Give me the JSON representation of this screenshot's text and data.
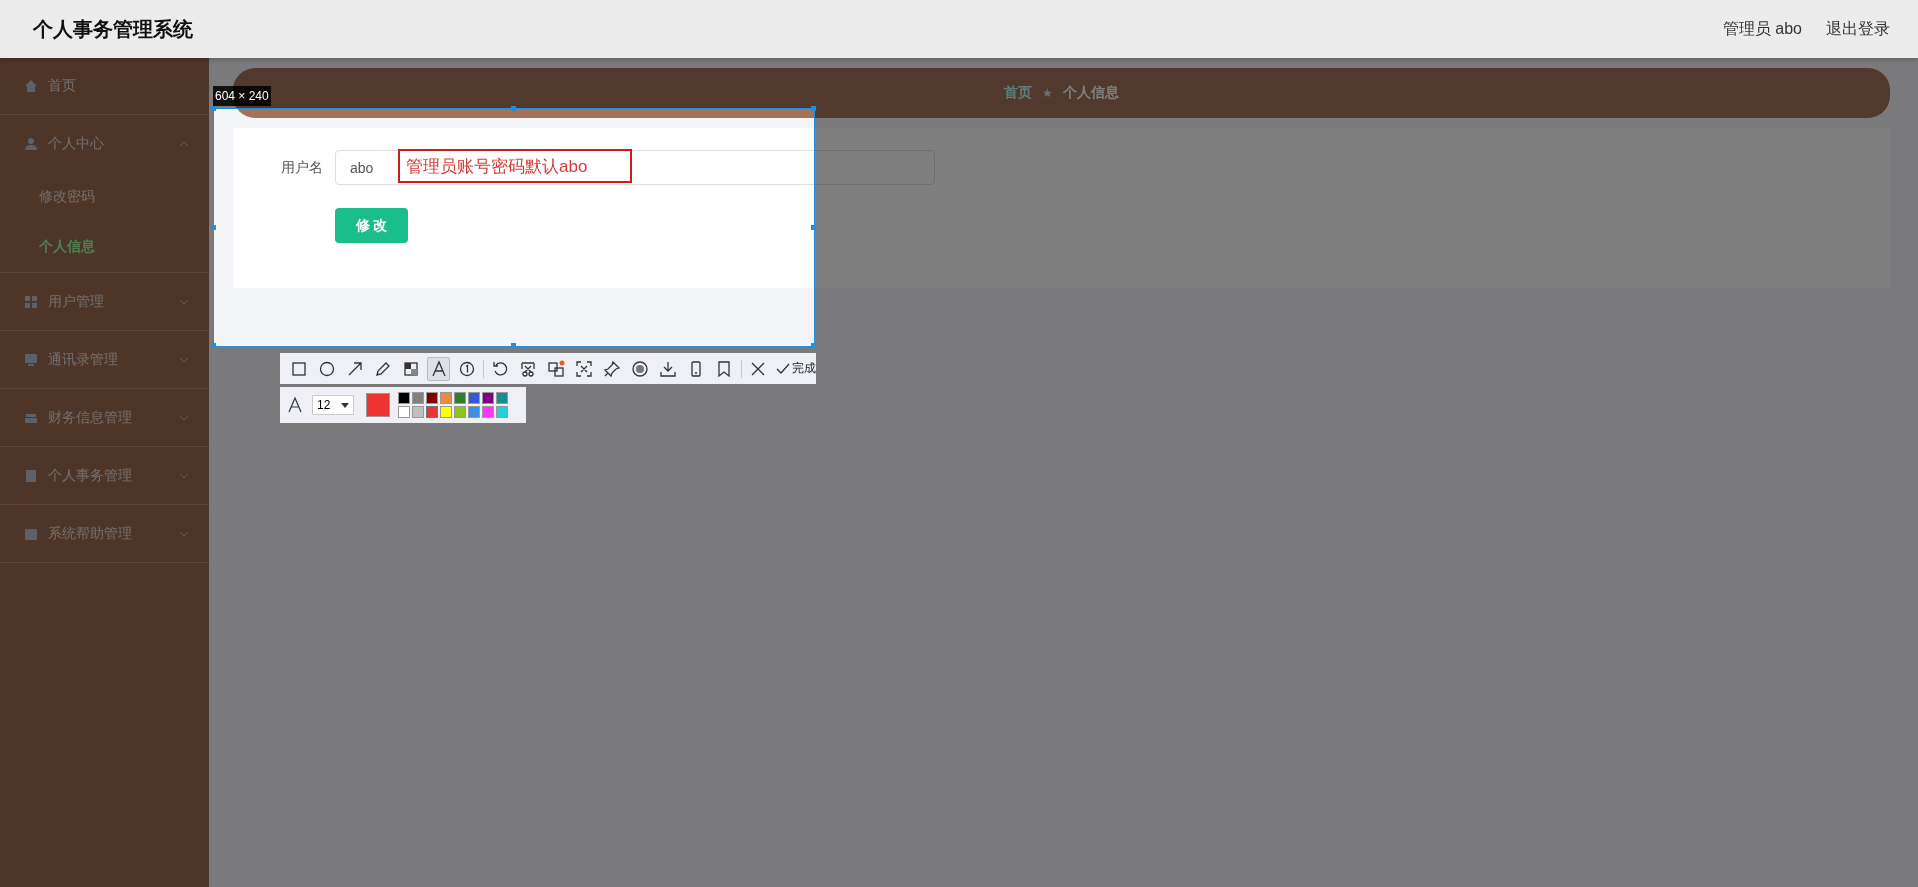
{
  "header": {
    "title": "个人事务管理系统",
    "user": "管理员 abo",
    "logout": "退出登录"
  },
  "sidebar": {
    "items": [
      {
        "kind": "link",
        "label": "首页"
      },
      {
        "kind": "group",
        "label": "个人中心",
        "expanded": true,
        "children": [
          {
            "label": "修改密码",
            "selected": false
          },
          {
            "label": "个人信息",
            "selected": true
          }
        ]
      },
      {
        "kind": "group",
        "label": "用户管理",
        "expanded": false
      },
      {
        "kind": "group",
        "label": "通讯录管理",
        "expanded": false
      },
      {
        "kind": "group",
        "label": "财务信息管理",
        "expanded": false
      },
      {
        "kind": "group",
        "label": "个人事务管理",
        "expanded": false
      },
      {
        "kind": "group",
        "label": "系统帮助管理",
        "expanded": false
      }
    ]
  },
  "breadcrumb": {
    "home": "首页",
    "separator": "★",
    "current": "个人信息"
  },
  "form": {
    "fields": [
      {
        "label": "用户名",
        "value": "abo"
      }
    ],
    "submit": "修 改"
  },
  "capture_tool": {
    "size_label": "604 × 240",
    "annotation": "管理员账号密码默认abo",
    "tools": [
      {
        "kind": "rectangle",
        "selected": false
      },
      {
        "kind": "ellipse",
        "selected": false
      },
      {
        "kind": "arrow",
        "selected": false
      },
      {
        "kind": "pencil",
        "selected": false
      },
      {
        "kind": "mosaic",
        "selected": false
      },
      {
        "kind": "text",
        "selected": true
      },
      {
        "kind": "number",
        "selected": false
      },
      {
        "kind": "divider"
      },
      {
        "kind": "undo",
        "selected": false
      },
      {
        "kind": "cut",
        "selected": false
      },
      {
        "kind": "translate",
        "selected": false
      },
      {
        "kind": "ocr",
        "selected": false
      },
      {
        "kind": "pin",
        "selected": false
      },
      {
        "kind": "record",
        "selected": false
      },
      {
        "kind": "download",
        "selected": false
      },
      {
        "kind": "phone",
        "selected": false
      },
      {
        "kind": "bookmark",
        "selected": false
      },
      {
        "kind": "divider"
      },
      {
        "kind": "close",
        "selected": false
      }
    ],
    "done_label": "完成",
    "font_size": "12",
    "palette": [
      {
        "color": "#000000",
        "selected": false
      },
      {
        "color": "#808080",
        "selected": false
      },
      {
        "color": "#800000",
        "selected": false
      },
      {
        "color": "#f08a3c",
        "selected": false
      },
      {
        "color": "#2e7d32",
        "selected": false
      },
      {
        "color": "#3a56d4",
        "selected": false
      },
      {
        "color": "#800080",
        "selected": false
      },
      {
        "color": "#10908f",
        "selected": false
      },
      {
        "color": "#ffffff",
        "selected": false
      },
      {
        "color": "#c0c0c0",
        "selected": false
      },
      {
        "color": "#ee3333",
        "selected": true
      },
      {
        "color": "#ffff00",
        "selected": false
      },
      {
        "color": "#8fc31f",
        "selected": false
      },
      {
        "color": "#3a8ee6",
        "selected": false
      },
      {
        "color": "#ff33ff",
        "selected": false
      },
      {
        "color": "#22d3dc",
        "selected": false
      }
    ]
  }
}
